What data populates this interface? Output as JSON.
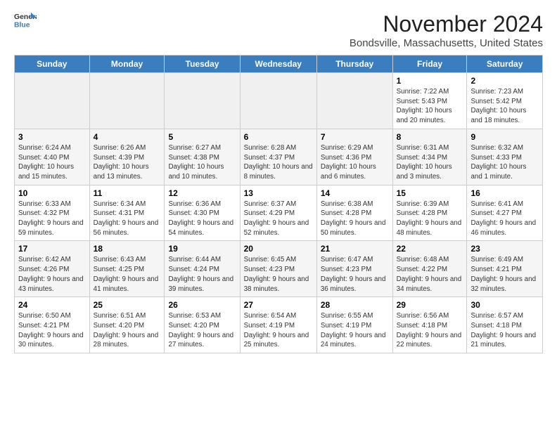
{
  "logo": {
    "line1": "General",
    "line2": "Blue"
  },
  "title": "November 2024",
  "subtitle": "Bondsville, Massachusetts, United States",
  "days_of_week": [
    "Sunday",
    "Monday",
    "Tuesday",
    "Wednesday",
    "Thursday",
    "Friday",
    "Saturday"
  ],
  "weeks": [
    [
      {
        "num": "",
        "info": ""
      },
      {
        "num": "",
        "info": ""
      },
      {
        "num": "",
        "info": ""
      },
      {
        "num": "",
        "info": ""
      },
      {
        "num": "",
        "info": ""
      },
      {
        "num": "1",
        "info": "Sunrise: 7:22 AM\nSunset: 5:43 PM\nDaylight: 10 hours and 20 minutes."
      },
      {
        "num": "2",
        "info": "Sunrise: 7:23 AM\nSunset: 5:42 PM\nDaylight: 10 hours and 18 minutes."
      }
    ],
    [
      {
        "num": "3",
        "info": "Sunrise: 6:24 AM\nSunset: 4:40 PM\nDaylight: 10 hours and 15 minutes."
      },
      {
        "num": "4",
        "info": "Sunrise: 6:26 AM\nSunset: 4:39 PM\nDaylight: 10 hours and 13 minutes."
      },
      {
        "num": "5",
        "info": "Sunrise: 6:27 AM\nSunset: 4:38 PM\nDaylight: 10 hours and 10 minutes."
      },
      {
        "num": "6",
        "info": "Sunrise: 6:28 AM\nSunset: 4:37 PM\nDaylight: 10 hours and 8 minutes."
      },
      {
        "num": "7",
        "info": "Sunrise: 6:29 AM\nSunset: 4:36 PM\nDaylight: 10 hours and 6 minutes."
      },
      {
        "num": "8",
        "info": "Sunrise: 6:31 AM\nSunset: 4:34 PM\nDaylight: 10 hours and 3 minutes."
      },
      {
        "num": "9",
        "info": "Sunrise: 6:32 AM\nSunset: 4:33 PM\nDaylight: 10 hours and 1 minute."
      }
    ],
    [
      {
        "num": "10",
        "info": "Sunrise: 6:33 AM\nSunset: 4:32 PM\nDaylight: 9 hours and 59 minutes."
      },
      {
        "num": "11",
        "info": "Sunrise: 6:34 AM\nSunset: 4:31 PM\nDaylight: 9 hours and 56 minutes."
      },
      {
        "num": "12",
        "info": "Sunrise: 6:36 AM\nSunset: 4:30 PM\nDaylight: 9 hours and 54 minutes."
      },
      {
        "num": "13",
        "info": "Sunrise: 6:37 AM\nSunset: 4:29 PM\nDaylight: 9 hours and 52 minutes."
      },
      {
        "num": "14",
        "info": "Sunrise: 6:38 AM\nSunset: 4:28 PM\nDaylight: 9 hours and 50 minutes."
      },
      {
        "num": "15",
        "info": "Sunrise: 6:39 AM\nSunset: 4:28 PM\nDaylight: 9 hours and 48 minutes."
      },
      {
        "num": "16",
        "info": "Sunrise: 6:41 AM\nSunset: 4:27 PM\nDaylight: 9 hours and 46 minutes."
      }
    ],
    [
      {
        "num": "17",
        "info": "Sunrise: 6:42 AM\nSunset: 4:26 PM\nDaylight: 9 hours and 43 minutes."
      },
      {
        "num": "18",
        "info": "Sunrise: 6:43 AM\nSunset: 4:25 PM\nDaylight: 9 hours and 41 minutes."
      },
      {
        "num": "19",
        "info": "Sunrise: 6:44 AM\nSunset: 4:24 PM\nDaylight: 9 hours and 39 minutes."
      },
      {
        "num": "20",
        "info": "Sunrise: 6:45 AM\nSunset: 4:23 PM\nDaylight: 9 hours and 38 minutes."
      },
      {
        "num": "21",
        "info": "Sunrise: 6:47 AM\nSunset: 4:23 PM\nDaylight: 9 hours and 36 minutes."
      },
      {
        "num": "22",
        "info": "Sunrise: 6:48 AM\nSunset: 4:22 PM\nDaylight: 9 hours and 34 minutes."
      },
      {
        "num": "23",
        "info": "Sunrise: 6:49 AM\nSunset: 4:21 PM\nDaylight: 9 hours and 32 minutes."
      }
    ],
    [
      {
        "num": "24",
        "info": "Sunrise: 6:50 AM\nSunset: 4:21 PM\nDaylight: 9 hours and 30 minutes."
      },
      {
        "num": "25",
        "info": "Sunrise: 6:51 AM\nSunset: 4:20 PM\nDaylight: 9 hours and 28 minutes."
      },
      {
        "num": "26",
        "info": "Sunrise: 6:53 AM\nSunset: 4:20 PM\nDaylight: 9 hours and 27 minutes."
      },
      {
        "num": "27",
        "info": "Sunrise: 6:54 AM\nSunset: 4:19 PM\nDaylight: 9 hours and 25 minutes."
      },
      {
        "num": "28",
        "info": "Sunrise: 6:55 AM\nSunset: 4:19 PM\nDaylight: 9 hours and 24 minutes."
      },
      {
        "num": "29",
        "info": "Sunrise: 6:56 AM\nSunset: 4:18 PM\nDaylight: 9 hours and 22 minutes."
      },
      {
        "num": "30",
        "info": "Sunrise: 6:57 AM\nSunset: 4:18 PM\nDaylight: 9 hours and 21 minutes."
      }
    ]
  ]
}
